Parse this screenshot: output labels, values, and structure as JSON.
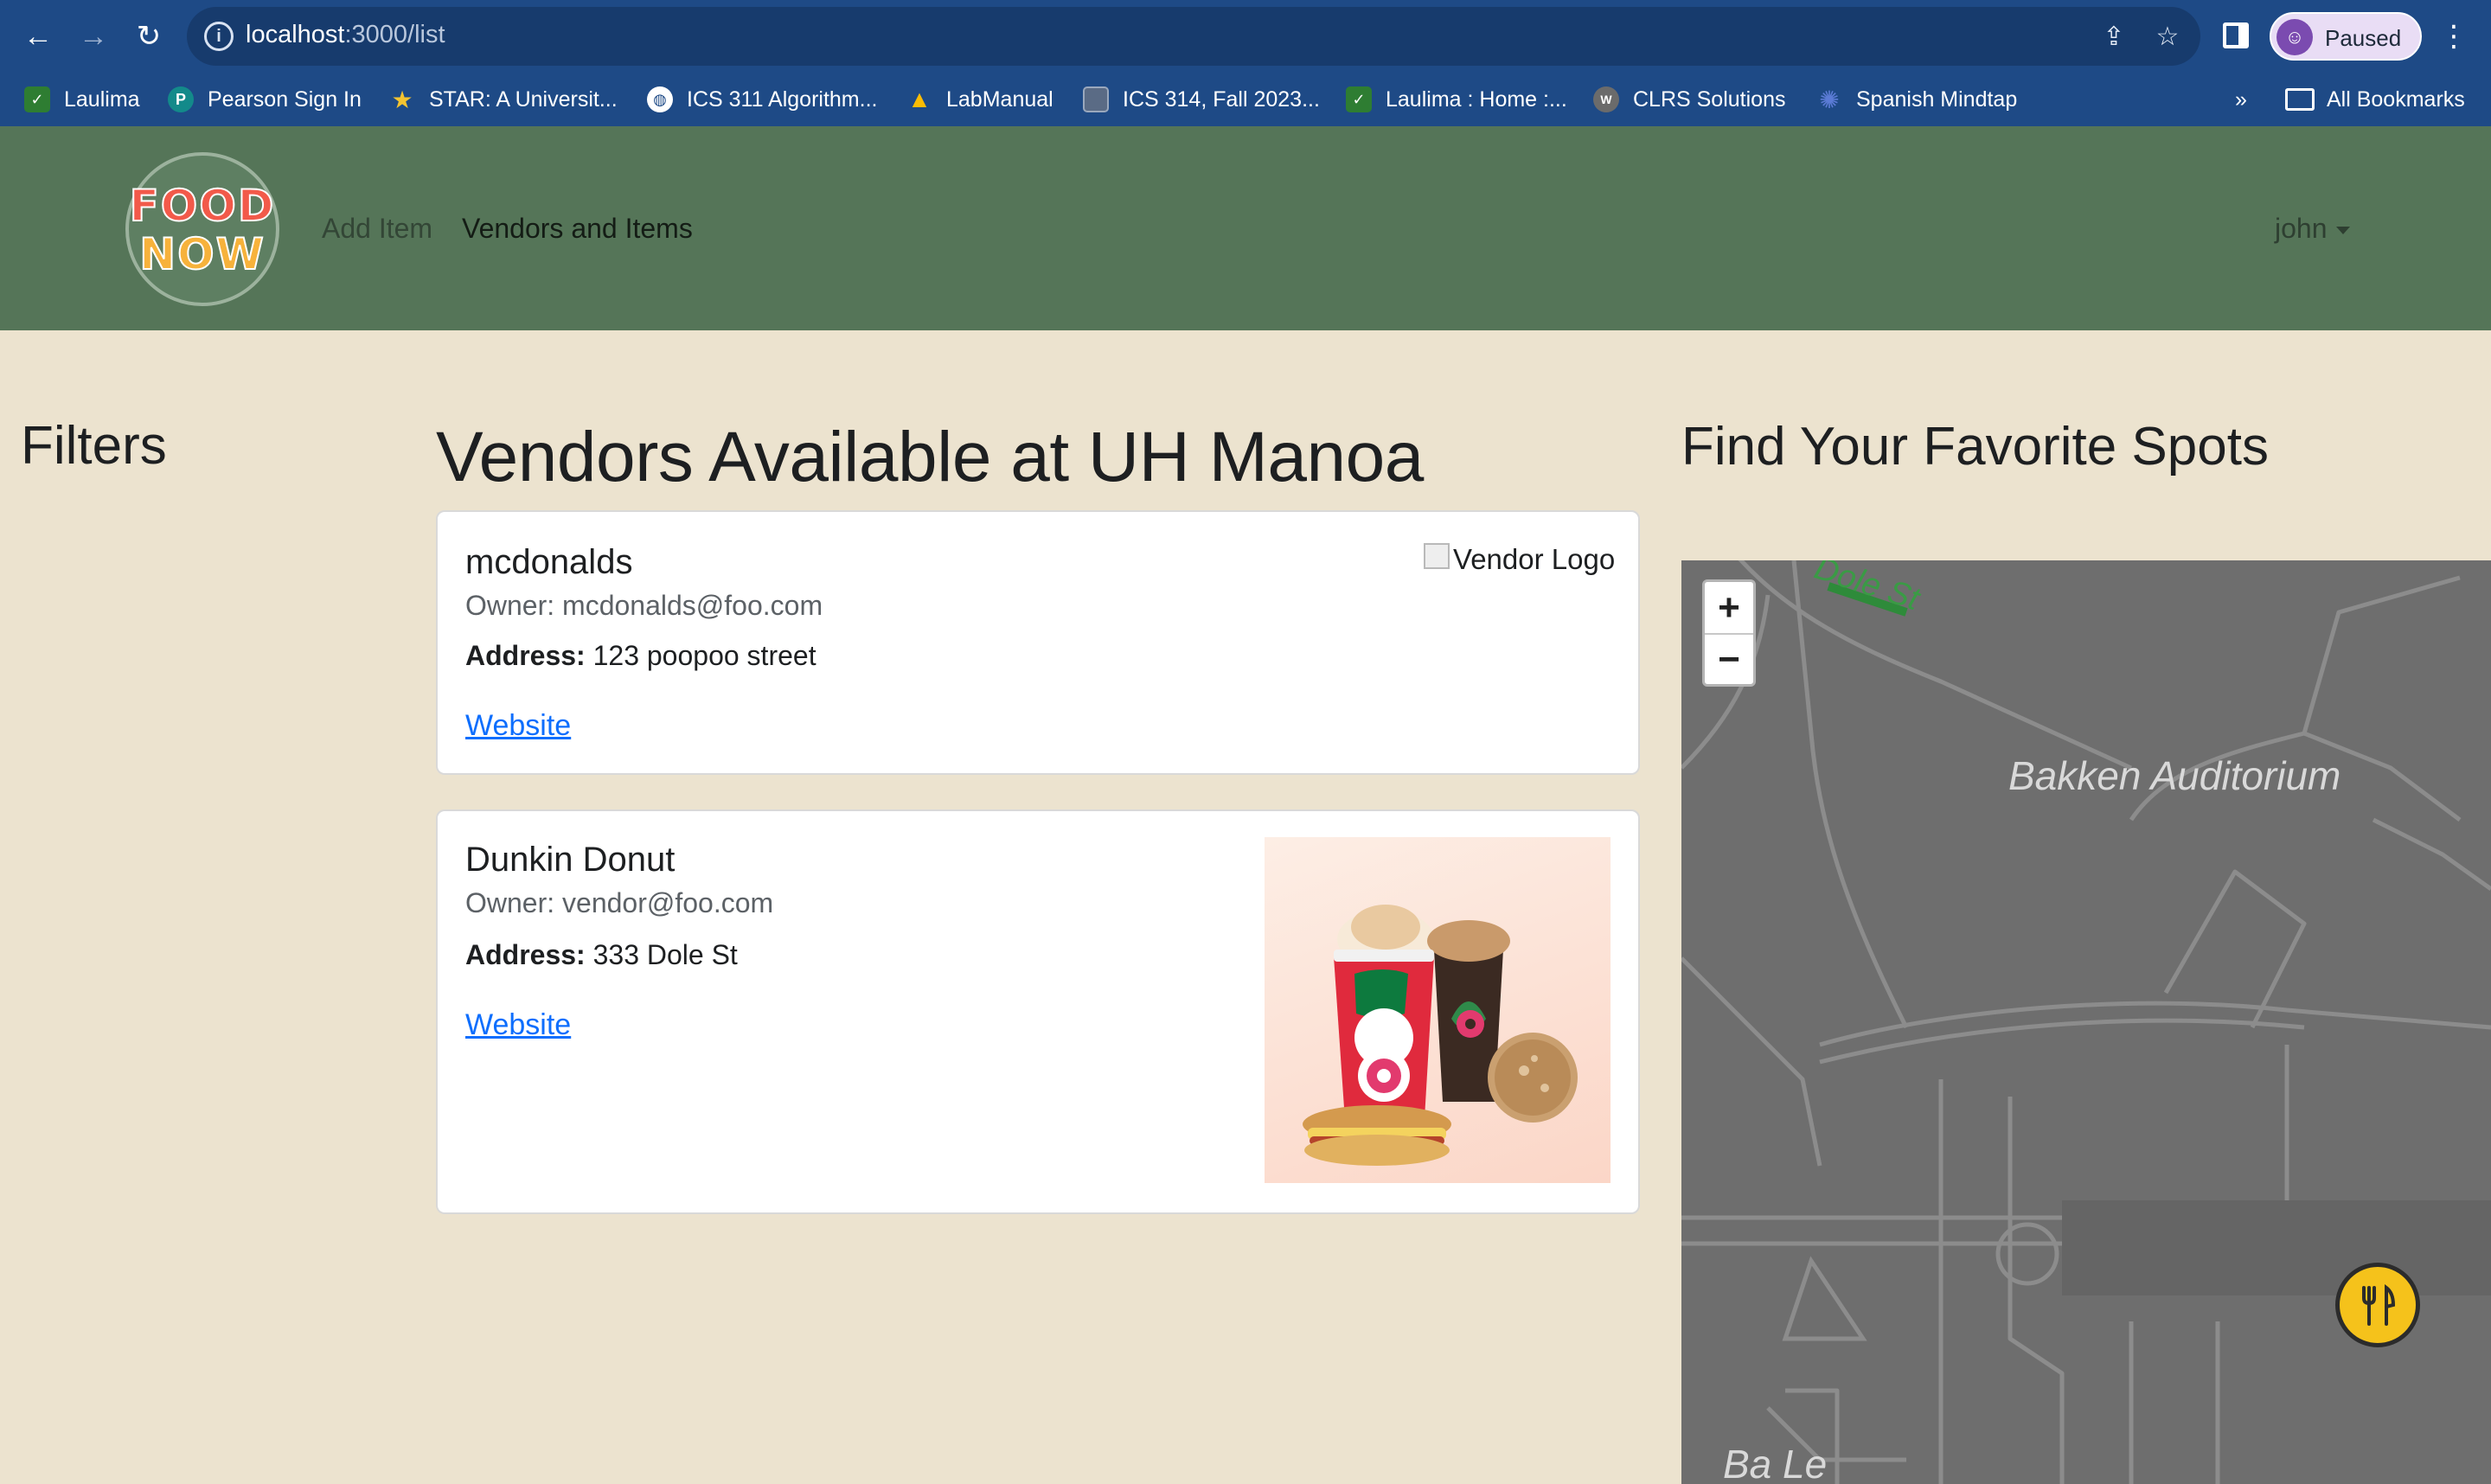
{
  "browser": {
    "url_host": "localhost",
    "url_path": ":3000/list",
    "profile_label": "Paused",
    "bookmarks": [
      {
        "label": "Laulima",
        "icon": "laulima-icon",
        "color": "#2e7d32"
      },
      {
        "label": "Pearson Sign In",
        "icon": "pearson-icon",
        "color": "#138a8a"
      },
      {
        "label": "STAR: A Universit...",
        "icon": "star-icon",
        "color": "#3c6fd1"
      },
      {
        "label": "ICS 311 Algorithm...",
        "icon": "globe-icon",
        "color": "#4b5d7a"
      },
      {
        "label": "LabManual",
        "icon": "drive-icon",
        "color": "#1e8e3e"
      },
      {
        "label": "ICS 314, Fall 2023...",
        "icon": "square-icon",
        "color": "#5a6b85"
      },
      {
        "label": "Laulima : Home :...",
        "icon": "laulima-icon",
        "color": "#2e7d32"
      },
      {
        "label": "CLRS Solutions",
        "icon": "walkccc-icon",
        "color": "#6b6b6b"
      },
      {
        "label": "Spanish Mindtap",
        "icon": "mindtap-icon",
        "color": "#2c4aa0"
      }
    ],
    "more_label": "»",
    "all_bookmarks_label": "All Bookmarks"
  },
  "navbar": {
    "logo_line1": "FOOD",
    "logo_line2": "NOW",
    "links": [
      {
        "label": "Add Item"
      },
      {
        "label": "Vendors and Items"
      }
    ],
    "user": "john"
  },
  "filters": {
    "title": "Filters"
  },
  "main": {
    "title": "Vendors Available at UH Manoa",
    "vendors": [
      {
        "name": "mcdonalds",
        "owner": "Owner: mcdonalds@foo.com",
        "address_label": "Address:",
        "address": "123 poopoo street",
        "website_label": "Website",
        "logo_alt": "Vendor Logo"
      },
      {
        "name": "Dunkin Donut",
        "owner": "Owner: vendor@foo.com",
        "address_label": "Address:",
        "address": "333 Dole St",
        "website_label": "Website"
      }
    ]
  },
  "map_panel": {
    "title": "Find Your Favorite Spots",
    "zoom_in": "+",
    "zoom_out": "−",
    "labels": {
      "auditorium": "Bakken Auditorium",
      "street_top": "Dole St",
      "street_bottom": "Ba Le"
    }
  }
}
